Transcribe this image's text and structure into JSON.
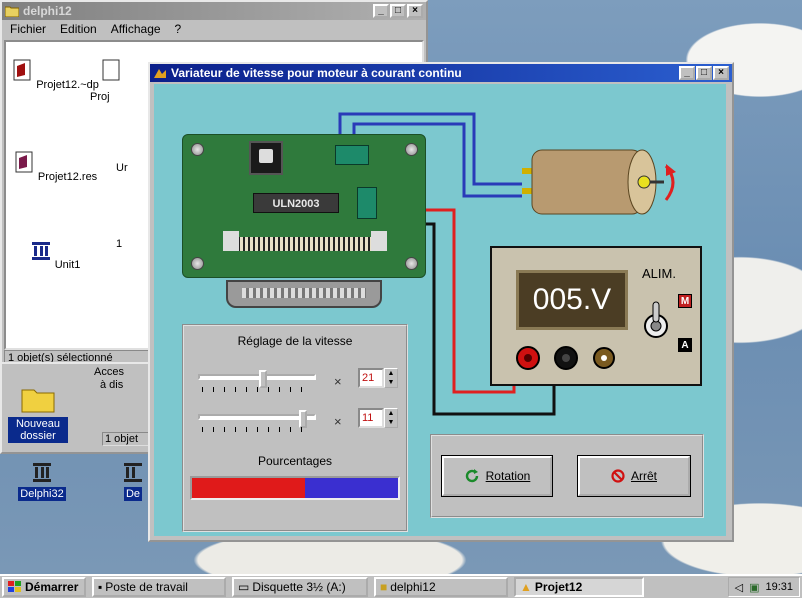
{
  "explorer": {
    "title": "delphi12",
    "menu": [
      "Fichier",
      "Edition",
      "Affichage",
      "?"
    ],
    "icons": [
      {
        "label": "Projet12.~dp"
      },
      {
        "label": "Proj"
      },
      {
        "label": "Projet12.res"
      },
      {
        "label": "Ur"
      },
      {
        "label": "Unit1"
      },
      {
        "label": "1"
      }
    ],
    "status": "1 objet(s) sélectionné"
  },
  "folder": {
    "lines": [
      "Acces",
      "à dis"
    ],
    "status": "1 objet"
  },
  "desktop": {
    "icons": [
      {
        "label": "Nouveau dossier"
      },
      {
        "label": "Delphi32"
      },
      {
        "label": "De"
      }
    ]
  },
  "app": {
    "title": "Variateur de vitesse pour moteur à courant continu",
    "chip": "ULN2003",
    "display": "005.V",
    "alim_label": "ALIM.",
    "switch_m": "M",
    "switch_a": "A",
    "speed_group_title": "Réglage de la vitesse",
    "multiplier_symbol": "×",
    "slider1": {
      "position": 0.55,
      "value": "21"
    },
    "slider2": {
      "position": 0.92,
      "value": "11"
    },
    "percent_title": "Pourcentages",
    "percent_split": 0.55,
    "rotation_label": "Rotation",
    "stop_label": "Arrêt"
  },
  "taskbar": {
    "start": "Démarrer",
    "tasks": [
      "Poste de travail",
      "Disquette 3½ (A:)",
      "delphi12",
      "Projet12"
    ],
    "clock": "19:31"
  },
  "colors": {
    "title_active": "#0b1f8a",
    "client_bg": "#7cc8cf",
    "pcb": "#2f7a3c",
    "bar_red": "#e01a1a",
    "bar_blue": "#3a2fd0"
  }
}
